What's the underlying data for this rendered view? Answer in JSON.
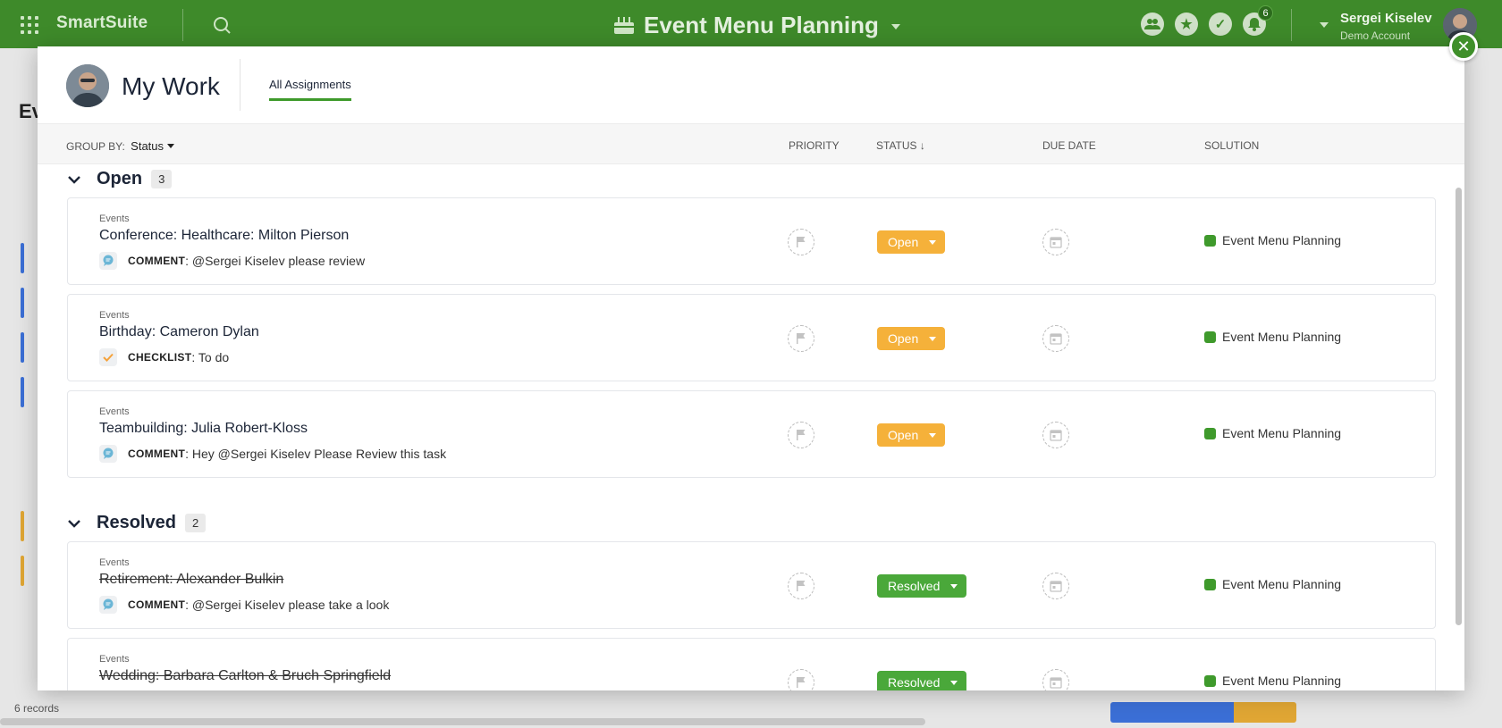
{
  "topbar": {
    "brand": "SmartSuite",
    "solution_title": "Event Menu Planning",
    "notification_count": "6",
    "user_name": "Sergei Kiselev",
    "user_subtitle": "Demo Account"
  },
  "background": {
    "page_title_fragment": "Ev",
    "records_label": "6 records"
  },
  "modal": {
    "title": "My Work",
    "tab_label": "All Assignments",
    "group_by_label": "GROUP BY:",
    "group_by_value": "Status",
    "columns": {
      "priority": "PRIORITY",
      "status": "STATUS ↓",
      "due_date": "DUE DATE",
      "solution": "SOLUTION"
    }
  },
  "groups": [
    {
      "title": "Open",
      "count": "3",
      "items": [
        {
          "app": "Events",
          "name": "Conference: Healthcare: Milton Pierson",
          "type": "COMMENT",
          "detail": ": @Sergei Kiselev please review",
          "status": "Open",
          "solution": "Event Menu Planning"
        },
        {
          "app": "Events",
          "name": "Birthday: Cameron Dylan",
          "type": "CHECKLIST",
          "detail": ": To do",
          "status": "Open",
          "solution": "Event Menu Planning"
        },
        {
          "app": "Events",
          "name": "Teambuilding: Julia Robert-Kloss",
          "type": "COMMENT",
          "detail": ": Hey @Sergei Kiselev Please Review this task",
          "status": "Open",
          "solution": "Event Menu Planning"
        }
      ]
    },
    {
      "title": "Resolved",
      "count": "2",
      "items": [
        {
          "app": "Events",
          "name": "Retirement: Alexander Bulkin",
          "type": "COMMENT",
          "detail": ": @Sergei Kiselev please take a look",
          "status": "Resolved",
          "solution": "Event Menu Planning"
        },
        {
          "app": "Events",
          "name": "Wedding: Barbara Carlton & Bruch Springfield",
          "status": "Resolved",
          "solution": "Event Menu Planning"
        }
      ]
    }
  ],
  "colors": {
    "topbar_green": "#3e8a2a",
    "open_status": "#f5b13a",
    "resolved_status": "#4aa83a",
    "solution_dot": "#3f9a2c"
  }
}
